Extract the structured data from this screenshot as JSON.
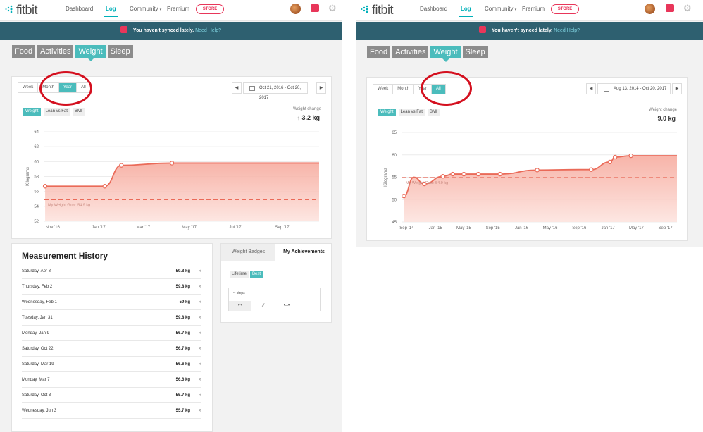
{
  "brand": {
    "name": "fitbit",
    "accent": "#00b0b9",
    "alert": "#e8365a"
  },
  "nav": {
    "dashboard": "Dashboard",
    "log": "Log",
    "community": "Community",
    "premium": "Premium",
    "store": "STORE"
  },
  "banner": {
    "text": "You haven't synced lately.",
    "help": "Need Help?"
  },
  "log_tabs": [
    "Food",
    "Activities",
    "Weight",
    "Sleep"
  ],
  "range_buttons": [
    "Week",
    "Month",
    "Year",
    "All"
  ],
  "chart_tabs": [
    "Weight",
    "Lean vs Fat",
    "BMI"
  ],
  "left": {
    "date_range": "Oct 21, 2016 - Oct 20, 2017",
    "active_range": "Year",
    "weight_change_label": "Weight change",
    "weight_change_value": "3.2 kg",
    "measurement_history_title": "Measurement History",
    "measurements": [
      {
        "date": "Saturday, Apr 8",
        "value": "59.8 kg"
      },
      {
        "date": "Thursday, Feb 2",
        "value": "59.8 kg"
      },
      {
        "date": "Wednesday, Feb 1",
        "value": "59 kg"
      },
      {
        "date": "Tuesday, Jan 31",
        "value": "59.8 kg"
      },
      {
        "date": "Monday, Jan 9",
        "value": "56.7 kg"
      },
      {
        "date": "Saturday, Oct 22",
        "value": "56.7 kg"
      },
      {
        "date": "Saturday, Mar 19",
        "value": "56.6 kg"
      },
      {
        "date": "Monday, Mar 7",
        "value": "56.6 kg"
      },
      {
        "date": "Saturday, Oct 3",
        "value": "55.7 kg"
      },
      {
        "date": "Wednesday, Jun 3",
        "value": "55.7 kg"
      }
    ],
    "delete_glyph": "×",
    "achievements": {
      "tabs": [
        "Weight Badges",
        "My Achievements"
      ],
      "buttons": [
        "Lifetime",
        "Best"
      ],
      "steps_label": "-- steps"
    }
  },
  "right": {
    "date_range": "Aug 13, 2014 - Oct 20, 2017",
    "active_range": "All",
    "weight_change_label": "Weight change",
    "weight_change_value": "9.0 kg"
  },
  "chart_data": [
    {
      "type": "area",
      "title": "",
      "ylabel": "Kilograms",
      "ylim": [
        52,
        64
      ],
      "yticks": [
        52,
        54,
        56,
        58,
        60,
        62,
        64
      ],
      "x_tick_labels": [
        "Nov '16",
        "Jan '17",
        "Mar '17",
        "May '17",
        "Jul '17",
        "Sep '17"
      ],
      "x_tick_dates": [
        "2016-11-01",
        "2017-01-01",
        "2017-03-01",
        "2017-05-01",
        "2017-07-01",
        "2017-09-01"
      ],
      "xlim": [
        "2016-10-21",
        "2017-10-20"
      ],
      "series": [
        {
          "name": "Weight",
          "x": [
            "2016-10-22",
            "2017-01-09",
            "2017-01-31",
            "2017-04-08",
            "2017-10-20"
          ],
          "values": [
            56.7,
            56.7,
            59.5,
            59.8,
            59.8
          ],
          "markers": [
            true,
            true,
            true,
            true,
            false
          ]
        }
      ],
      "goal": {
        "label": "My Weight Goal: 54.9 kg",
        "value": 54.9
      }
    },
    {
      "type": "area",
      "title": "",
      "ylabel": "Kilograms",
      "ylim": [
        45,
        65
      ],
      "yticks": [
        45,
        50,
        55,
        60,
        65
      ],
      "x_tick_labels": [
        "Sep '14",
        "Jan '15",
        "May '15",
        "Sep '15",
        "Jan '16",
        "May '16",
        "Sep '16",
        "Jan '17",
        "May '17",
        "Sep '17"
      ],
      "x_tick_dates": [
        "2014-09-01",
        "2015-01-01",
        "2015-05-01",
        "2015-09-01",
        "2016-01-01",
        "2016-05-01",
        "2016-09-01",
        "2017-01-01",
        "2017-05-01",
        "2017-09-01"
      ],
      "xlim": [
        "2014-08-13",
        "2017-10-20"
      ],
      "series": [
        {
          "name": "Weight",
          "x": [
            "2014-08-20",
            "2014-10-01",
            "2014-11-15",
            "2015-02-01",
            "2015-03-15",
            "2015-05-01",
            "2015-07-01",
            "2015-10-01",
            "2016-03-07",
            "2016-09-01",
            "2016-10-22",
            "2017-01-09",
            "2017-01-31",
            "2017-04-08",
            "2017-10-20"
          ],
          "values": [
            50.8,
            55.0,
            53.5,
            55.2,
            55.7,
            55.7,
            55.7,
            55.7,
            56.6,
            56.7,
            56.7,
            58.4,
            59.5,
            59.8,
            59.8
          ],
          "markers": [
            true,
            false,
            true,
            true,
            true,
            true,
            true,
            true,
            true,
            false,
            true,
            true,
            true,
            true,
            false
          ]
        }
      ],
      "goal": {
        "label": "My Weight Goal: 54.9 kg",
        "value": 54.9
      }
    }
  ]
}
